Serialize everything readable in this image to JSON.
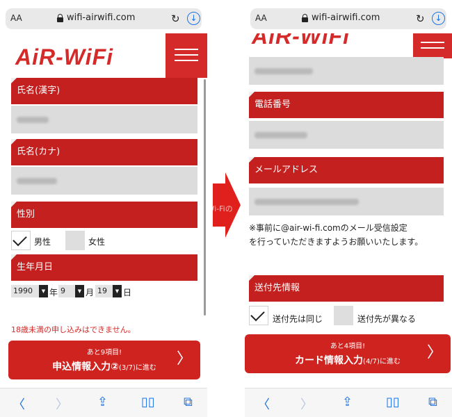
{
  "left": {
    "browser": {
      "aa_label": "AA",
      "url": "wifi-airwifi.com"
    },
    "logo_text": "AiR-WiFi",
    "fields": {
      "name_kanji_label": "氏名(漢字)",
      "name_kana_label": "氏名(カナ)",
      "gender_label": "性別",
      "male_label": "男性",
      "female_label": "女性",
      "birth_label": "生年月日"
    },
    "birth": {
      "year": "1990",
      "year_unit": "年",
      "month": "9",
      "month_unit": "月",
      "day": "19",
      "day_unit": "日"
    },
    "warning": "18歳未満の申し込みはできません。",
    "cta": {
      "line1": "あと9項目!",
      "line2_main": "申込情報入力②",
      "line2_small": "(3/7)に進む",
      "chevron": "〉"
    }
  },
  "right": {
    "browser": {
      "aa_label": "AA",
      "url": "wifi-airwifi.com"
    },
    "logo_text": "AiR-WiFi",
    "fields": {
      "phone_label": "電話番号",
      "email_label": "メールアドレス",
      "shipping_label": "送付先情報",
      "same_label": "送付先は同じ",
      "different_label": "送付先が異なる"
    },
    "note_line1": "※事前に@air-wi-fi.comのメール受信設定",
    "note_line2": "を行っていただきますようお願いいたします。",
    "cta": {
      "line1": "あと4項目!",
      "line2_main": "カード情報入力",
      "line2_small": "(4/7)に進む",
      "chevron": "〉"
    }
  },
  "watermark": "© Wi-Fiの",
  "icons": {
    "lock": "lock-icon",
    "reload": "reload-icon",
    "download": "download-icon",
    "menu": "hamburger-icon",
    "back": "chevron-left-icon",
    "forward": "chevron-right-icon",
    "share": "share-icon",
    "bookmarks": "book-icon",
    "tabs": "tabs-icon"
  },
  "colors": {
    "brand_red": "#c3201f",
    "arrow_red": "#e0201c",
    "link_blue": "#1a73e8"
  }
}
